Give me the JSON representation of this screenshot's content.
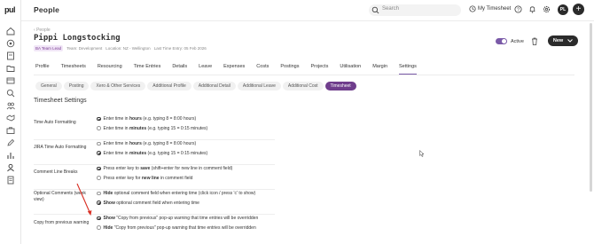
{
  "app": {
    "logo": "pul",
    "section_title": "People"
  },
  "topbar": {
    "search_placeholder": "Search",
    "my_timesheet": "My Timesheet",
    "avatar_initials": "PL"
  },
  "header": {
    "breadcrumb": "People",
    "name": "Pippi Longstocking",
    "badge": "BA Team Lead",
    "team": "Team: Development",
    "location": "Location: NZ - Wellington",
    "last_timing": "Last Time Entry: 05 Feb 2026",
    "active_label": "Active",
    "new_button": "New"
  },
  "tabs": [
    "Profile",
    "Timesheets",
    "Resourcing",
    "Time Entries",
    "Details",
    "Leave",
    "Expenses",
    "Costs",
    "Postings",
    "Projects",
    "Utilisation",
    "Margin",
    "Settings"
  ],
  "active_tab": "Settings",
  "subtabs": [
    "General",
    "Posting",
    "Xero & Other Services",
    "Additional Profile",
    "Additional Detail",
    "Additional Leave",
    "Additional Cost",
    "Timesheet"
  ],
  "active_subtab": "Timesheet",
  "settings": {
    "title": "Timesheet Settings",
    "rows": [
      {
        "label": "Time Auto Formatting",
        "options": [
          {
            "pre": "Enter time in ",
            "bold": "hours",
            "post": " (e.g. typing 8 = 8:00 hours)",
            "selected": true
          },
          {
            "pre": "Enter time in ",
            "bold": "minutes",
            "post": " (e.g. typing 15 = 0:15 minutes)",
            "selected": false
          }
        ]
      },
      {
        "label": "JIRA Time Auto Formatting",
        "options": [
          {
            "pre": "Enter time in ",
            "bold": "hours",
            "post": " (e.g. typing 8 = 8:00 hours)",
            "selected": false
          },
          {
            "pre": "Enter time in ",
            "bold": "minutes",
            "post": " (e.g. typing 15 = 0:15 minutes)",
            "selected": true
          }
        ]
      },
      {
        "label": "Comment Line Breaks",
        "options": [
          {
            "pre": "Press enter key to ",
            "bold": "save",
            "post": " (shift+enter for new line in comment field)",
            "selected": true
          },
          {
            "pre": "Press enter key for ",
            "bold": "new line",
            "post": " in comment field",
            "selected": false
          }
        ]
      },
      {
        "label": "Optional Comments (week view)",
        "options": [
          {
            "pre": "",
            "bold": "Hide",
            "post": " optional comment field when entering time (click icon / press 'c' to show)",
            "selected": false
          },
          {
            "pre": "",
            "bold": "Show",
            "post": " optional comment field when entering time",
            "selected": true
          }
        ]
      },
      {
        "label": "Copy from previous warning",
        "options": [
          {
            "pre": "",
            "bold": "Show",
            "post": " \"Copy from previous\" pop-up warning that time entries will be overridden",
            "selected": true
          },
          {
            "pre": "",
            "bold": "Hide",
            "post": " \"Copy from previous\" pop-up warning that time entries will be overridden",
            "selected": false
          }
        ]
      }
    ]
  },
  "colors": {
    "accent": "#6f3d8c",
    "annotation_arrow": "#d93025"
  }
}
